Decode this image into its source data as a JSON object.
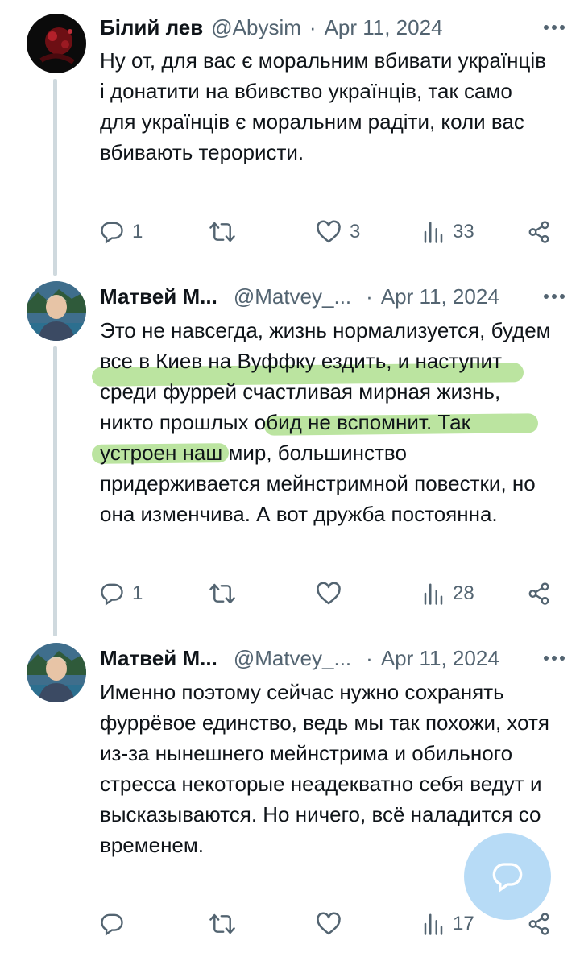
{
  "tweets": [
    {
      "name": "Білий лев",
      "handle": "@Abysim",
      "separator": "·",
      "date": "Apr 11, 2024",
      "text": "Ну от, для вас є моральним вбивати українців і донатити на вбивство українців, так само для українців є моральним радіти, коли вас вбивають терористи.",
      "replies": "1",
      "retweets": "",
      "likes": "3",
      "views": "33",
      "avatar_icon": "dark-red-avatar"
    },
    {
      "name": "Матвей М...",
      "handle": "@Matvey_...",
      "separator": "·",
      "date": "Apr 11, 2024",
      "text": "Это не навсегда, жизнь нормализуется, будем все в Киев на Вуффку ездить, и наступит среди фуррей счастливая мирная жизнь, никто прошлых обид не вспомнит. Так устроен наш мир, большинство придерживается мейнстримной повестки, но она изменчива. А вот дружба постоянна.",
      "replies": "1",
      "retweets": "",
      "likes": "",
      "views": "28",
      "avatar_icon": "person-photo-avatar"
    },
    {
      "name": "Матвей М...",
      "handle": "@Matvey_...",
      "separator": "·",
      "date": "Apr 11, 2024",
      "text": "Именно поэтому сейчас нужно сохранять фуррёвое единство, ведь мы так похожи, хотя из-за нынешнего мейнстрима и обильного стресса некоторые неадекватно себя ведут и высказываются. Но ничего, всё наладится со временем.",
      "replies": "",
      "retweets": "",
      "likes": "",
      "views": "17",
      "avatar_icon": "person-photo-avatar"
    }
  ],
  "highlight_color": "#84ce52",
  "accent_color": "#1d9bf0",
  "icons": [
    "more-icon",
    "reply-icon",
    "retweet-icon",
    "like-icon",
    "views-icon",
    "share-icon",
    "compose-reply-icon"
  ]
}
